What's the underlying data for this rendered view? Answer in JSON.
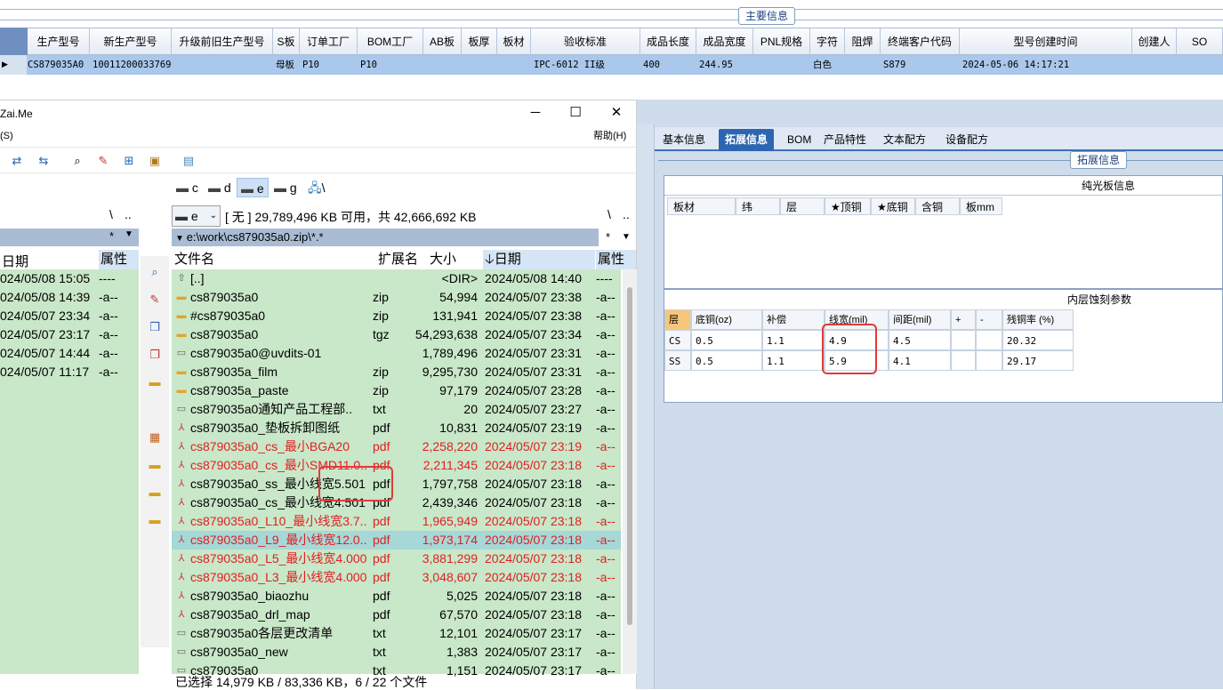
{
  "erp": {
    "main_info_title": "主要信息",
    "columns": [
      "生产型号",
      "新生产型号",
      "升级前旧生产型号",
      "S板",
      "订单工厂",
      "BOM工厂",
      "AB板",
      "板厚",
      "板材",
      "验收标准",
      "成品长度",
      "成品宽度",
      "PNL规格",
      "字符",
      "阻焊",
      "终端客户代码",
      "型号创建时间",
      "创建人",
      "SO"
    ],
    "row": [
      "CS879035A0",
      "10011200033769",
      "",
      "母板",
      "P10",
      "P10",
      "",
      "",
      "",
      "IPC-6012 II级",
      "400",
      "244.95",
      "",
      "白色",
      "",
      "S879",
      "2024-05-06 14:17:21",
      "",
      ""
    ]
  },
  "tabs": [
    "基本信息",
    "拓展信息",
    "BOM",
    "产品特性",
    "文本配方",
    "设备配方"
  ],
  "active_tab": "拓展信息",
  "ext_title": "拓展信息",
  "bare_board": {
    "title": "纯光板信息",
    "headers": [
      "板材",
      "纬",
      "层",
      "★顶铜",
      "★底铜",
      "含铜",
      "板mm"
    ]
  },
  "etch": {
    "title": "内层蚀刻参数",
    "headers": [
      "层",
      "底铜(oz)",
      "补偿",
      "线宽(mil)",
      "间距(mil)",
      "+",
      "-",
      "残铜率 (%)"
    ],
    "rows": [
      [
        "CS",
        "0.5",
        "1.1",
        "4.9",
        "4.5",
        "",
        "",
        "20.32"
      ],
      [
        "SS",
        "0.5",
        "1.1",
        "5.9",
        "4.1",
        "",
        "",
        "29.17"
      ]
    ]
  },
  "tc": {
    "title": "Zai.Me",
    "menu_left": "(S)",
    "menu_help": "帮助(H)",
    "drives": [
      "c",
      "d",
      "e",
      "g",
      "\\"
    ],
    "left_nav": [
      "\\",
      "..",
      "*"
    ],
    "right_nav": [
      "\\",
      "..",
      "*"
    ],
    "drive_combo": "e",
    "free_space": "[ 无 ]  29,789,496 KB 可用，共 42,666,692 KB",
    "path": "e:\\work\\cs879035a0.zip\\*.*",
    "left_headers": {
      "date": "日期",
      "attr": "属性"
    },
    "left_rows": [
      [
        "024/05/08 15:05",
        "----"
      ],
      [
        "024/05/08 14:39",
        "-a--"
      ],
      [
        "024/05/07 23:34",
        "-a--"
      ],
      [
        "024/05/07 23:17",
        "-a--"
      ],
      [
        "024/05/07 14:44",
        "-a--"
      ],
      [
        "024/05/07 11:17",
        "-a--"
      ]
    ],
    "headers": {
      "name": "文件名",
      "ext": "扩展名",
      "size": "大小",
      "date": "日期",
      "attr": "属性"
    },
    "files": [
      {
        "icon": "up",
        "name": "[..]",
        "ext": "",
        "size": "<DIR>",
        "date": "2024/05/08 14:40",
        "attr": "----",
        "red": false
      },
      {
        "icon": "zip",
        "name": "cs879035a0",
        "ext": "zip",
        "size": "54,994",
        "date": "2024/05/07 23:38",
        "attr": "-a--",
        "red": false
      },
      {
        "icon": "zip",
        "name": "#cs879035a0",
        "ext": "zip",
        "size": "131,941",
        "date": "2024/05/07 23:38",
        "attr": "-a--",
        "red": false
      },
      {
        "icon": "zip",
        "name": "cs879035a0",
        "ext": "tgz",
        "size": "54,293,638",
        "date": "2024/05/07 23:34",
        "attr": "-a--",
        "red": false
      },
      {
        "icon": "file",
        "name": "cs879035a0@uvdits-01",
        "ext": "",
        "size": "1,789,496",
        "date": "2024/05/07 23:31",
        "attr": "-a--",
        "red": false
      },
      {
        "icon": "zip",
        "name": "cs879035a_film",
        "ext": "zip",
        "size": "9,295,730",
        "date": "2024/05/07 23:31",
        "attr": "-a--",
        "red": false
      },
      {
        "icon": "zip",
        "name": "cs879035a_paste",
        "ext": "zip",
        "size": "97,179",
        "date": "2024/05/07 23:28",
        "attr": "-a--",
        "red": false
      },
      {
        "icon": "file",
        "name": "cs879035a0通知产品工程部..",
        "ext": "txt",
        "size": "20",
        "date": "2024/05/07 23:27",
        "attr": "-a--",
        "red": false
      },
      {
        "icon": "pdf",
        "name": "cs879035a0_垫板拆卸图纸",
        "ext": "pdf",
        "size": "10,831",
        "date": "2024/05/07 23:19",
        "attr": "-a--",
        "red": false
      },
      {
        "icon": "pdf",
        "name": "cs879035a0_cs_最小BGA20",
        "ext": "pdf",
        "size": "2,258,220",
        "date": "2024/05/07 23:19",
        "attr": "-a--",
        "red": true
      },
      {
        "icon": "pdf",
        "name": "cs879035a0_cs_最小SMD11.0..",
        "ext": "pdf",
        "size": "2,211,345",
        "date": "2024/05/07 23:18",
        "attr": "-a--",
        "red": true
      },
      {
        "icon": "pdf",
        "name": "cs879035a0_ss_最小线宽5.501",
        "ext": "pdf",
        "size": "1,797,758",
        "date": "2024/05/07 23:18",
        "attr": "-a--",
        "red": false
      },
      {
        "icon": "pdf",
        "name": "cs879035a0_cs_最小线宽4.501",
        "ext": "pdf",
        "size": "2,439,346",
        "date": "2024/05/07 23:18",
        "attr": "-a--",
        "red": false
      },
      {
        "icon": "pdf",
        "name": "cs879035a0_L10_最小线宽3.7..",
        "ext": "pdf",
        "size": "1,965,949",
        "date": "2024/05/07 23:18",
        "attr": "-a--",
        "red": true
      },
      {
        "icon": "pdf",
        "name": "cs879035a0_L9_最小线宽12.0..",
        "ext": "pdf",
        "size": "1,973,174",
        "date": "2024/05/07 23:18",
        "attr": "-a--",
        "red": true,
        "selected": true
      },
      {
        "icon": "pdf",
        "name": "cs879035a0_L5_最小线宽4.000",
        "ext": "pdf",
        "size": "3,881,299",
        "date": "2024/05/07 23:18",
        "attr": "-a--",
        "red": true
      },
      {
        "icon": "pdf",
        "name": "cs879035a0_L3_最小线宽4.000",
        "ext": "pdf",
        "size": "3,048,607",
        "date": "2024/05/07 23:18",
        "attr": "-a--",
        "red": true
      },
      {
        "icon": "pdf",
        "name": "cs879035a0_biaozhu",
        "ext": "pdf",
        "size": "5,025",
        "date": "2024/05/07 23:18",
        "attr": "-a--",
        "red": false
      },
      {
        "icon": "pdf",
        "name": "cs879035a0_drl_map",
        "ext": "pdf",
        "size": "67,570",
        "date": "2024/05/07 23:18",
        "attr": "-a--",
        "red": false
      },
      {
        "icon": "file",
        "name": "cs879035a0各层更改清单",
        "ext": "txt",
        "size": "12,101",
        "date": "2024/05/07 23:17",
        "attr": "-a--",
        "red": false
      },
      {
        "icon": "file",
        "name": "cs879035a0_new",
        "ext": "txt",
        "size": "1,383",
        "date": "2024/05/07 23:17",
        "attr": "-a--",
        "red": false
      },
      {
        "icon": "file",
        "name": "cs879035a0",
        "ext": "txt",
        "size": "1,151",
        "date": "2024/05/07 23:17",
        "attr": "-a--",
        "red": false
      }
    ],
    "status": "已选择 14,979 KB / 83,336 KB，6 / 22 个文件"
  }
}
